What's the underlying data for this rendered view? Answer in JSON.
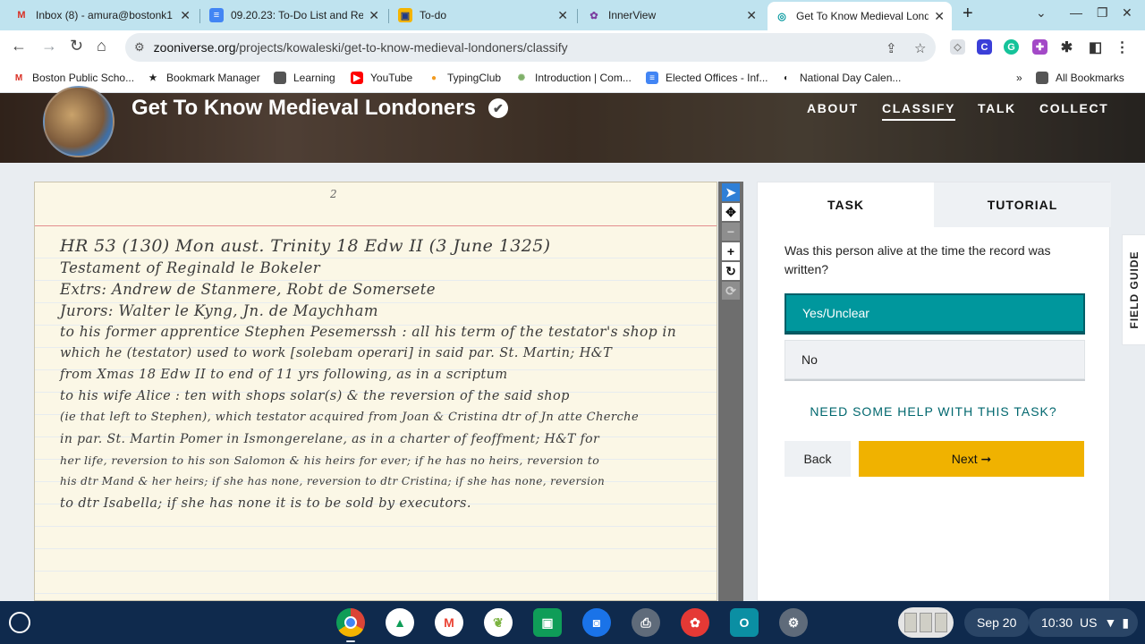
{
  "browser": {
    "tabs": [
      {
        "title": "Inbox (8) - amura@bostonk1",
        "icon_text": "M",
        "icon_color": "#d93025",
        "active": false
      },
      {
        "title": "09.20.23: To-Do List and Re",
        "icon_text": "≡",
        "icon_color": "#4285f4",
        "active": false
      },
      {
        "title": "To-do",
        "icon_text": "▣",
        "icon_color": "#f4b400",
        "active": false
      },
      {
        "title": "InnerView",
        "icon_text": "✿",
        "icon_color": "#7b3fa0",
        "active": false
      },
      {
        "title": "Get To Know Medieval Londo",
        "icon_text": "◎",
        "icon_color": "#00979d",
        "active": true
      }
    ],
    "new_tab": "+",
    "url_host": "zooniverse.org",
    "url_path": "/projects/kowaleski/get-to-know-medieval-londoners/classify",
    "bookmarks": [
      {
        "label": "Boston Public Scho...",
        "icon_text": "M",
        "icon_color": "#d93025"
      },
      {
        "label": "Bookmark Manager",
        "icon_text": "★",
        "icon_color": "#222222"
      },
      {
        "label": "Learning",
        "icon_text": "▬",
        "icon_color": "#555555"
      },
      {
        "label": "YouTube",
        "icon_text": "▶",
        "icon_color": "#ff0000"
      },
      {
        "label": "TypingClub",
        "icon_text": "●",
        "icon_color": "#f29b21"
      },
      {
        "label": "Introduction | Com...",
        "icon_text": "✺",
        "icon_color": "#7fb069"
      },
      {
        "label": "Elected Offices - Inf...",
        "icon_text": "≡",
        "icon_color": "#4285f4"
      },
      {
        "label": "National Day Calen...",
        "icon_text": "◐",
        "icon_color": "#222222"
      }
    ],
    "bookmarks_overflow": "»",
    "all_bookmarks": "All Bookmarks"
  },
  "project": {
    "title": "Get To Know Medieval Londoners",
    "nav": [
      "ABOUT",
      "CLASSIFY",
      "TALK",
      "COLLECT"
    ],
    "active_nav": "CLASSIFY"
  },
  "subject": {
    "page_number": "2",
    "lines": [
      "HR 53 (130)     Mon  aust.  Trinity  18 Edw II   (3 June 1325)",
      "Testament of  Reginald le Bokeler",
      "Extrs:  Andrew de Stanmere,  Robt de Somersete",
      "Jurors:  Walter le Kyng,  Jn. de Maychham",
      "to  his former apprentice  Stephen Pesemerssh :  all his term of the testator's shop in",
      "which  he (testator) used to work [solebam operari]  in  said par.  St. Martin;  H&T",
      "from Xmas 18 Edw II  to end  of  11 yrs  following,   as  in   a  scriptum",
      "to his wife Alice :  ten  with  shops  solar(s)  &  the  reversion  of  the  said  shop",
      "(ie that left to Stephen),  which testator acquired  from Joan & Cristina dtr of Jn atte Cherche",
      "in par. St. Martin Pomer   in  Ismongerelane,  as  in a charter  of feoffment;  H&T for",
      "her life,  reversion to  his son   Salomon   & his heirs for ever;  if he has no heirs,  reversion to",
      "his dtr  Mand  &  her heirs;  if she has none,  reversion to  dtr Cristina;  if she has none,  reversion",
      "to  dtr  Isabella;   if  she  has  none   it  is   to be  sold   by   executors."
    ]
  },
  "task": {
    "tabs": [
      "TASK",
      "TUTORIAL"
    ],
    "question": "Was this person alive at the time the record was written?",
    "answers": [
      {
        "label": "Yes/Unclear",
        "selected": true
      },
      {
        "label": "No",
        "selected": false
      }
    ],
    "help_link": "NEED SOME HELP WITH THIS TASK?",
    "back_label": "Back",
    "next_label": "Next ➞",
    "field_guide": "FIELD GUIDE"
  },
  "shelf": {
    "apps": [
      {
        "name": "chrome",
        "icon_text": "◉",
        "color": "#db4437",
        "dot": true
      },
      {
        "name": "drive",
        "icon_text": "▲",
        "color": "#0f9d58",
        "dot": false
      },
      {
        "name": "gmail",
        "icon_text": "M",
        "color": "#ea4335",
        "dot": false
      },
      {
        "name": "sheets-leaf",
        "icon_text": "❦",
        "color": "#7cb342",
        "dot": false
      },
      {
        "name": "classroom",
        "icon_text": "▣",
        "color": "#0f9d58",
        "dot": false
      },
      {
        "name": "camera",
        "icon_text": "◙",
        "color": "#1a73e8",
        "dot": false
      },
      {
        "name": "printer",
        "icon_text": "⎙",
        "color": "#5f6b7a",
        "dot": false
      },
      {
        "name": "paint",
        "icon_text": "✿",
        "color": "#e53935",
        "dot": false
      },
      {
        "name": "outlook",
        "icon_text": "O",
        "color": "#0b8fa3",
        "dot": false
      },
      {
        "name": "settings",
        "icon_text": "⚙",
        "color": "#5f6b7a",
        "dot": false
      }
    ],
    "date": "Sep 20",
    "time": "10:30",
    "locale": "US"
  }
}
